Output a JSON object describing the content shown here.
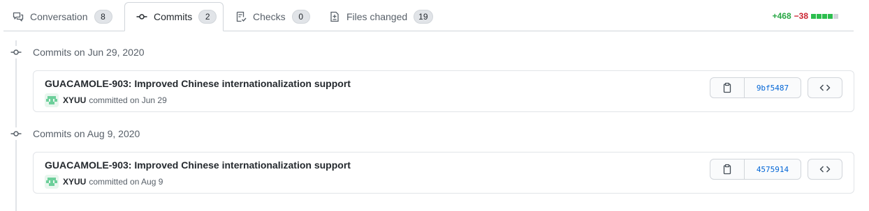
{
  "tabs": [
    {
      "label": "Conversation",
      "count": "8",
      "icon": "comment-discussion-icon"
    },
    {
      "label": "Commits",
      "count": "2",
      "icon": "git-commit-icon"
    },
    {
      "label": "Checks",
      "count": "0",
      "icon": "checklist-icon"
    },
    {
      "label": "Files changed",
      "count": "19",
      "icon": "file-diff-icon"
    }
  ],
  "selected_tab": "Commits",
  "diffstat": {
    "additions": "+468",
    "deletions": "−38",
    "blocks": [
      "green",
      "green",
      "green",
      "green",
      "neutral"
    ]
  },
  "commit_groups": [
    {
      "date_label": "Commits on Jun 29, 2020",
      "commits": [
        {
          "message": "GUACAMOLE-903: Improved Chinese internationalization support",
          "author": "XYUU",
          "committed_text": "committed on Jun 29",
          "sha": "9bf5487"
        }
      ]
    },
    {
      "date_label": "Commits on Aug 9, 2020",
      "commits": [
        {
          "message": "GUACAMOLE-903: Improved Chinese internationalization support",
          "author": "XYUU",
          "committed_text": "committed on Aug 9",
          "sha": "4575914"
        }
      ]
    }
  ],
  "colors": {
    "additions": "#28a745",
    "deletions": "#cb2431",
    "link": "#0366d6"
  }
}
